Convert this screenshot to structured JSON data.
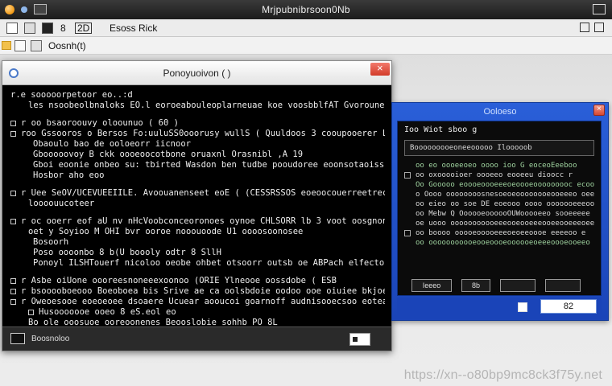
{
  "topbar": {
    "title": "Mrjpubnibrsoon0Nb"
  },
  "toolbar": {
    "label_a": "8",
    "label_b": "2D",
    "label_c": "Esoss Rick",
    "right_label": "□"
  },
  "toolbar2": {
    "label": "Oosnh(t)"
  },
  "main_window": {
    "title": "Ponoyuoivon ( )",
    "lines": [
      {
        "text": "r.e sooooorpetoor eo..:d",
        "bullet": false,
        "style": ""
      },
      {
        "text": "les nsoobeolbnaloks EO.l eoroeabouleoplarneuae koe voosbblfAT Gvoroune WAR.",
        "bullet": false,
        "style": "indent2"
      },
      {
        "text": "r oo bsaoroouvy oloounuo ( 60 )",
        "bullet": true,
        "style": ""
      },
      {
        "text": "roo Gssooros o Bersos Fo:uuluSS0ooorusy wullS ( Quuldoos 3 cooupooerer LUKSS",
        "bullet": true,
        "style": ""
      },
      {
        "text": "Obaoulo bao de ooloeorr iicnoor",
        "bullet": false,
        "style": "indent"
      },
      {
        "text": "Gbooooovoy B ckk oooeoocotbone oruaxnl  Orasnibl ,A 19",
        "bullet": false,
        "style": "indent"
      },
      {
        "text": "Gboi eoonie onbeo su: tbirted Wasdon ben tudbe pooudoree eoonsotaoiss,",
        "bullet": false,
        "style": "indent"
      },
      {
        "text": "Hosbor aho eoo",
        "bullet": false,
        "style": "indent"
      },
      {
        "text": "r Uee SeOV/UCEVUEEIILE. Avoouanenseet eoE ( (CESSRSSOS eoeoocouerreetrecoeci",
        "bullet": true,
        "style": ""
      },
      {
        "text": "loooouucoteer",
        "bullet": false,
        "style": "indent2"
      },
      {
        "text": "r oc ooerr eof aU nv nHcVoobconceoronoes oynoe CHLSORR lb 3 voot oosgnone eoeie t.",
        "bullet": true,
        "style": ""
      },
      {
        "text": "oet y Soyioo M OHI bvr ooroe nooouoode  U1 oooosoonosee",
        "bullet": false,
        "style": "indent2"
      },
      {
        "text": "Bosoorh",
        "bullet": false,
        "style": "indent3"
      },
      {
        "text": "Poso oooonbo 8 b(U boooly odtr 8 SllH",
        "bullet": false,
        "style": "indent3"
      },
      {
        "text": "Ponoyl ILSHTouerf nicoloo oeobe ohbet otsoorr outsb oe ABPach elfectorOVoOUBNNI,",
        "bullet": false,
        "style": "indent3"
      },
      {
        "text": "r Asbe oiUone oooreesnoneeexoonoo (ORIE Ylneooe oossdobe ( ESB",
        "bullet": true,
        "style": ""
      },
      {
        "text": "r bsooooboeooo Boeoboea bis Srive ae ca oolsbdoie oodoo ooe oiuiee bkjoeroy.",
        "bullet": true,
        "style": ""
      },
      {
        "text": "r Oweoesooe eoeoeoee dsoaere Ucuear aooucoi goarnoff audnisooecsoo eoteaoosl.",
        "bullet": true,
        "style": ""
      },
      {
        "text": "Husooooooe  ooeo  8 eS.eol eo",
        "bullet": true,
        "style": "indent2"
      },
      {
        "text": "Bo ole ooosuoe ooreoonenes Beooslobie sohhb PO 8L",
        "bullet": false,
        "style": "indent2"
      }
    ],
    "status_text": "Boosnoloo"
  },
  "side_window": {
    "title": "Ooloeso",
    "header": "Ioo Wiot sboo g",
    "inner_line": "Booooooooeoneeooooo Ilooooob",
    "lines": [
      {
        "text": "oo eo oooeeoeo oooo ioo G eoceoEeeboo",
        "box": false,
        "style": "green indent"
      },
      {
        "text": "oo oxooooioer oooeeo eooeeu dioocc r",
        "box": true,
        "style": ""
      },
      {
        "text": "Oo Gooooo eoooeoooeeeoeoooeooooooooc ecooee",
        "box": false,
        "style": "green indent"
      },
      {
        "text": "o Oooo oooooooosnesoeoeoooooooeooeeeo oeeooo",
        "box": false,
        "style": "indent"
      },
      {
        "text": "oo eieo oo soe DE eoeooo oooo ooooooeeeooee",
        "box": false,
        "style": "indent"
      },
      {
        "text": "oo Mebw Q OooooeoooooOUWooooeeo sooeeeee",
        "box": false,
        "style": "indent"
      },
      {
        "text": "oe uooo ooooooooooeeeooeooeeeooeeooeeeoee",
        "box": false,
        "style": "indent"
      },
      {
        "text": "oo boooo ooooeooooeeeoeoeeoooe eeeeoo e",
        "box": true,
        "style": ""
      },
      {
        "text": "oo ooooooooooeooeoooeoooooeoeeeoooeooeeo",
        "box": false,
        "style": "green indent"
      }
    ],
    "buttons": [
      "Ieeeo",
      "8b",
      ""
    ],
    "footer_value": "82"
  },
  "watermark": "https://xn--o80bp9mc8ck3f75y.net"
}
